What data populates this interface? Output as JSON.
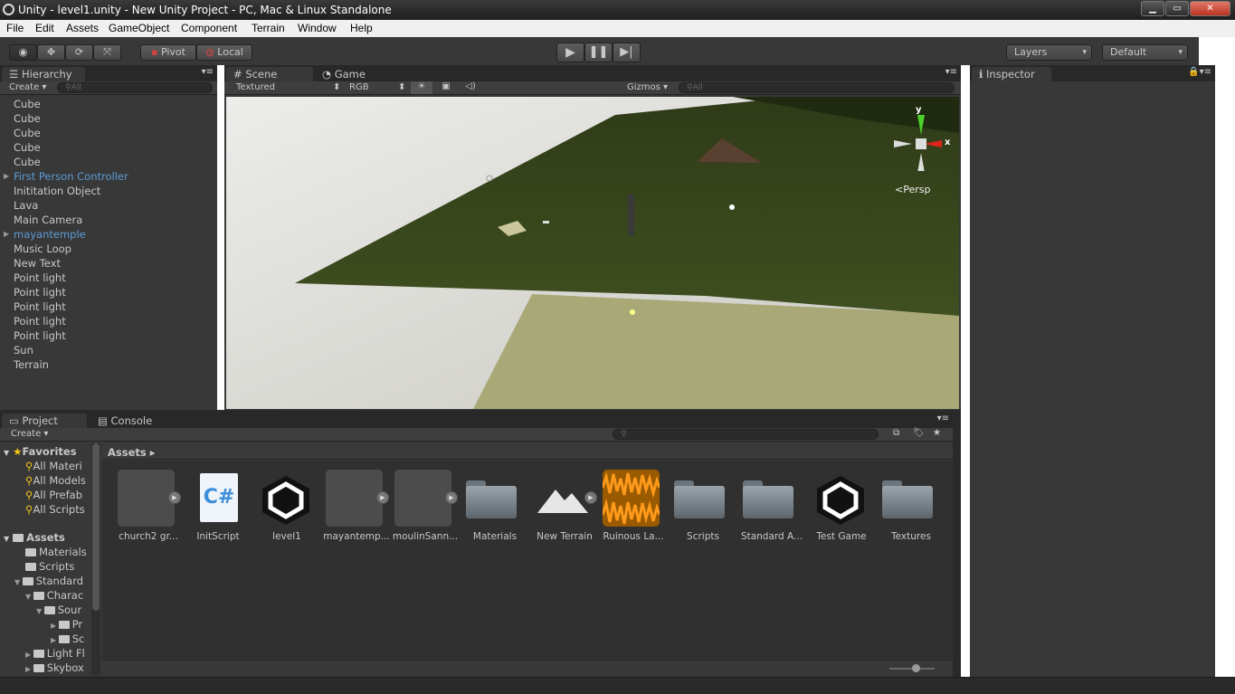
{
  "window": {
    "title": "Unity - level1.unity - New Unity Project - PC, Mac & Linux Standalone"
  },
  "menu": [
    "File",
    "Edit",
    "Assets",
    "GameObject",
    "Component",
    "Terrain",
    "Window",
    "Help"
  ],
  "toolbar": {
    "pivot": "Pivot",
    "local": "Local",
    "layers": "Layers",
    "layout": "Default"
  },
  "hierarchy": {
    "tab": "Hierarchy",
    "create": "Create",
    "search_placeholder": "All",
    "items": [
      {
        "label": "Cube",
        "prefab": false,
        "expandable": false
      },
      {
        "label": "Cube",
        "prefab": false,
        "expandable": false
      },
      {
        "label": "Cube",
        "prefab": false,
        "expandable": false
      },
      {
        "label": "Cube",
        "prefab": false,
        "expandable": false
      },
      {
        "label": "Cube",
        "prefab": false,
        "expandable": false
      },
      {
        "label": "First Person Controller",
        "prefab": true,
        "expandable": true
      },
      {
        "label": "Inititation Object",
        "prefab": false,
        "expandable": false
      },
      {
        "label": "Lava",
        "prefab": false,
        "expandable": false
      },
      {
        "label": "Main Camera",
        "prefab": false,
        "expandable": false
      },
      {
        "label": "mayantemple",
        "prefab": true,
        "expandable": true
      },
      {
        "label": "Music Loop",
        "prefab": false,
        "expandable": false
      },
      {
        "label": "New Text",
        "prefab": false,
        "expandable": false
      },
      {
        "label": "Point light",
        "prefab": false,
        "expandable": false
      },
      {
        "label": "Point light",
        "prefab": false,
        "expandable": false
      },
      {
        "label": "Point light",
        "prefab": false,
        "expandable": false
      },
      {
        "label": "Point light",
        "prefab": false,
        "expandable": false
      },
      {
        "label": "Point light",
        "prefab": false,
        "expandable": false
      },
      {
        "label": "Sun",
        "prefab": false,
        "expandable": false
      },
      {
        "label": "Terrain",
        "prefab": false,
        "expandable": false
      }
    ]
  },
  "scene": {
    "tab_scene": "Scene",
    "tab_game": "Game",
    "render_mode": "Textured",
    "color_mode": "RGB",
    "gizmos": "Gizmos",
    "search_placeholder": "All",
    "axis_y": "y",
    "axis_x": "x",
    "projection": "Persp"
  },
  "inspector": {
    "tab": "Inspector"
  },
  "project": {
    "tab_project": "Project",
    "tab_console": "Console",
    "create": "Create",
    "breadcrumb": "Assets",
    "favorites_label": "Favorites",
    "favorites": [
      "All Materi",
      "All Models",
      "All Prefab",
      "All Scripts"
    ],
    "assets_label": "Assets",
    "tree": [
      {
        "label": "Materials"
      },
      {
        "label": "Scripts"
      },
      {
        "label": "Standard"
      },
      {
        "label": "Charac"
      },
      {
        "label": "Sour"
      },
      {
        "label": "Pr"
      },
      {
        "label": "Sc"
      },
      {
        "label": "Light Fl"
      },
      {
        "label": "Skybox"
      }
    ],
    "assets": [
      {
        "label": "church2 gr...",
        "kind": "model"
      },
      {
        "label": "InitScript",
        "kind": "script"
      },
      {
        "label": "level1",
        "kind": "scene"
      },
      {
        "label": "mayantemp...",
        "kind": "model"
      },
      {
        "label": "moulinSann...",
        "kind": "model"
      },
      {
        "label": "Materials",
        "kind": "folder"
      },
      {
        "label": "New Terrain",
        "kind": "terrain"
      },
      {
        "label": "Ruinous La...",
        "kind": "audio"
      },
      {
        "label": "Scripts",
        "kind": "folder"
      },
      {
        "label": "Standard A...",
        "kind": "folder"
      },
      {
        "label": "Test Game",
        "kind": "scene"
      },
      {
        "label": "Textures",
        "kind": "folder"
      }
    ]
  },
  "colors": {
    "panel": "#383838",
    "prefab_text": "#5b9bd5",
    "grass": "#3b4a1e",
    "lava_ground": "#a9a877",
    "sky": "#dcdcd6"
  }
}
